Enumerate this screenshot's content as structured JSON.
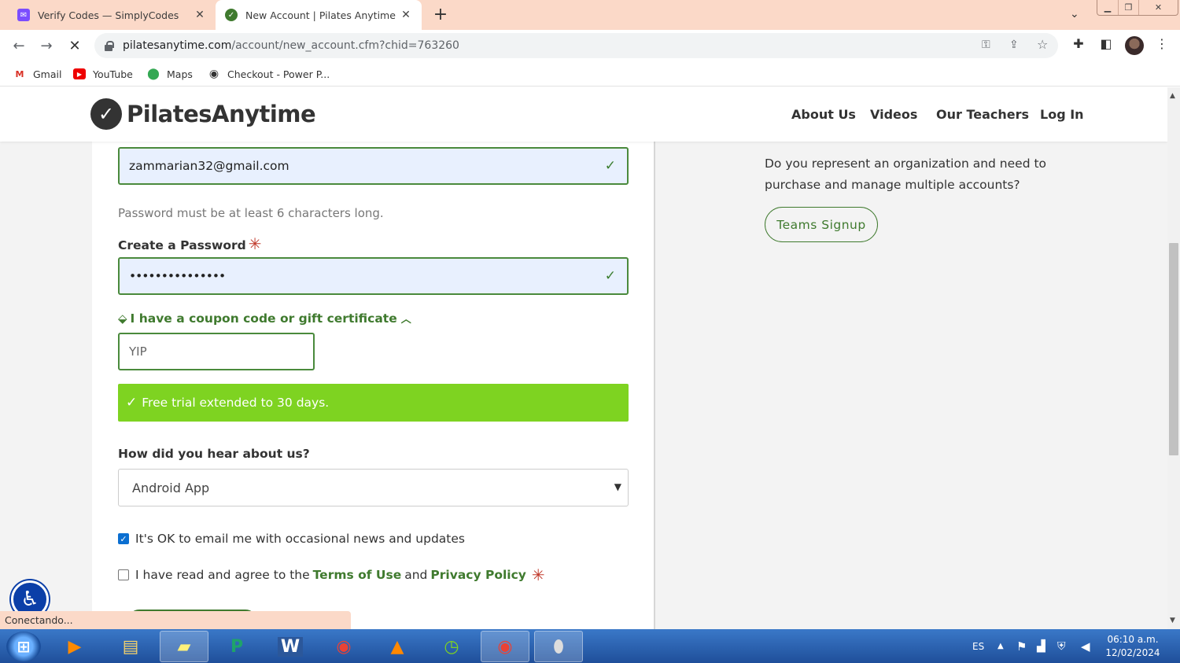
{
  "browser": {
    "tabs": [
      {
        "title": "Verify Codes — SimplyCodes",
        "favicon": "simplycodes-icon",
        "close": "✕"
      },
      {
        "title": "New Account | Pilates Anytime",
        "favicon": "pilates-anytime-icon",
        "close": "✕",
        "active": true
      }
    ],
    "new_tab": "+",
    "url_host": "pilatesanytime.com",
    "url_path": "/account/new_account.cfm?chid=763260",
    "bookmarks": [
      {
        "label": "Gmail",
        "icon": "gmail-icon"
      },
      {
        "label": "YouTube",
        "icon": "youtube-icon"
      },
      {
        "label": "Maps",
        "icon": "maps-icon"
      },
      {
        "label": "Checkout - Power P...",
        "icon": "checkout-icon"
      }
    ],
    "status": "Conectando..."
  },
  "site": {
    "logo": "PilatesAnytime",
    "nav": [
      "About Us",
      "Videos",
      "Our Teachers",
      "Log In"
    ]
  },
  "form": {
    "email_value": "zammarian32@gmail.com",
    "password_hint": "Password must be at least 6 characters long.",
    "password_label": "Create a Password",
    "password_value": "•••••••••••••••",
    "required_mark": "✳",
    "coupon_toggle": "I have a coupon code or gift certificate",
    "coupon_value": "YIP",
    "success_message": "Free trial extended to 30 days.",
    "hear_label": "How did you hear about us?",
    "hear_selected": "Android App",
    "email_opt_in": {
      "label": "It's OK to email me with occasional news and updates",
      "checked": true
    },
    "agree": {
      "prefix": "I have read and agree to the",
      "terms": "Terms of Use",
      "and": "and",
      "privacy": "Privacy Policy",
      "checked": false
    }
  },
  "sidebar": {
    "teams_text": "Do you represent an organization and need to purchase and manage multiple accounts?",
    "teams_button": "Teams Signup"
  },
  "taskbar": {
    "language": "ES",
    "time": "06:10 a.m.",
    "date": "12/02/2024"
  },
  "colors": {
    "brand_green": "#3f7a2e",
    "success_green": "#7ed321",
    "tab_strip": "#fbd9c8"
  }
}
